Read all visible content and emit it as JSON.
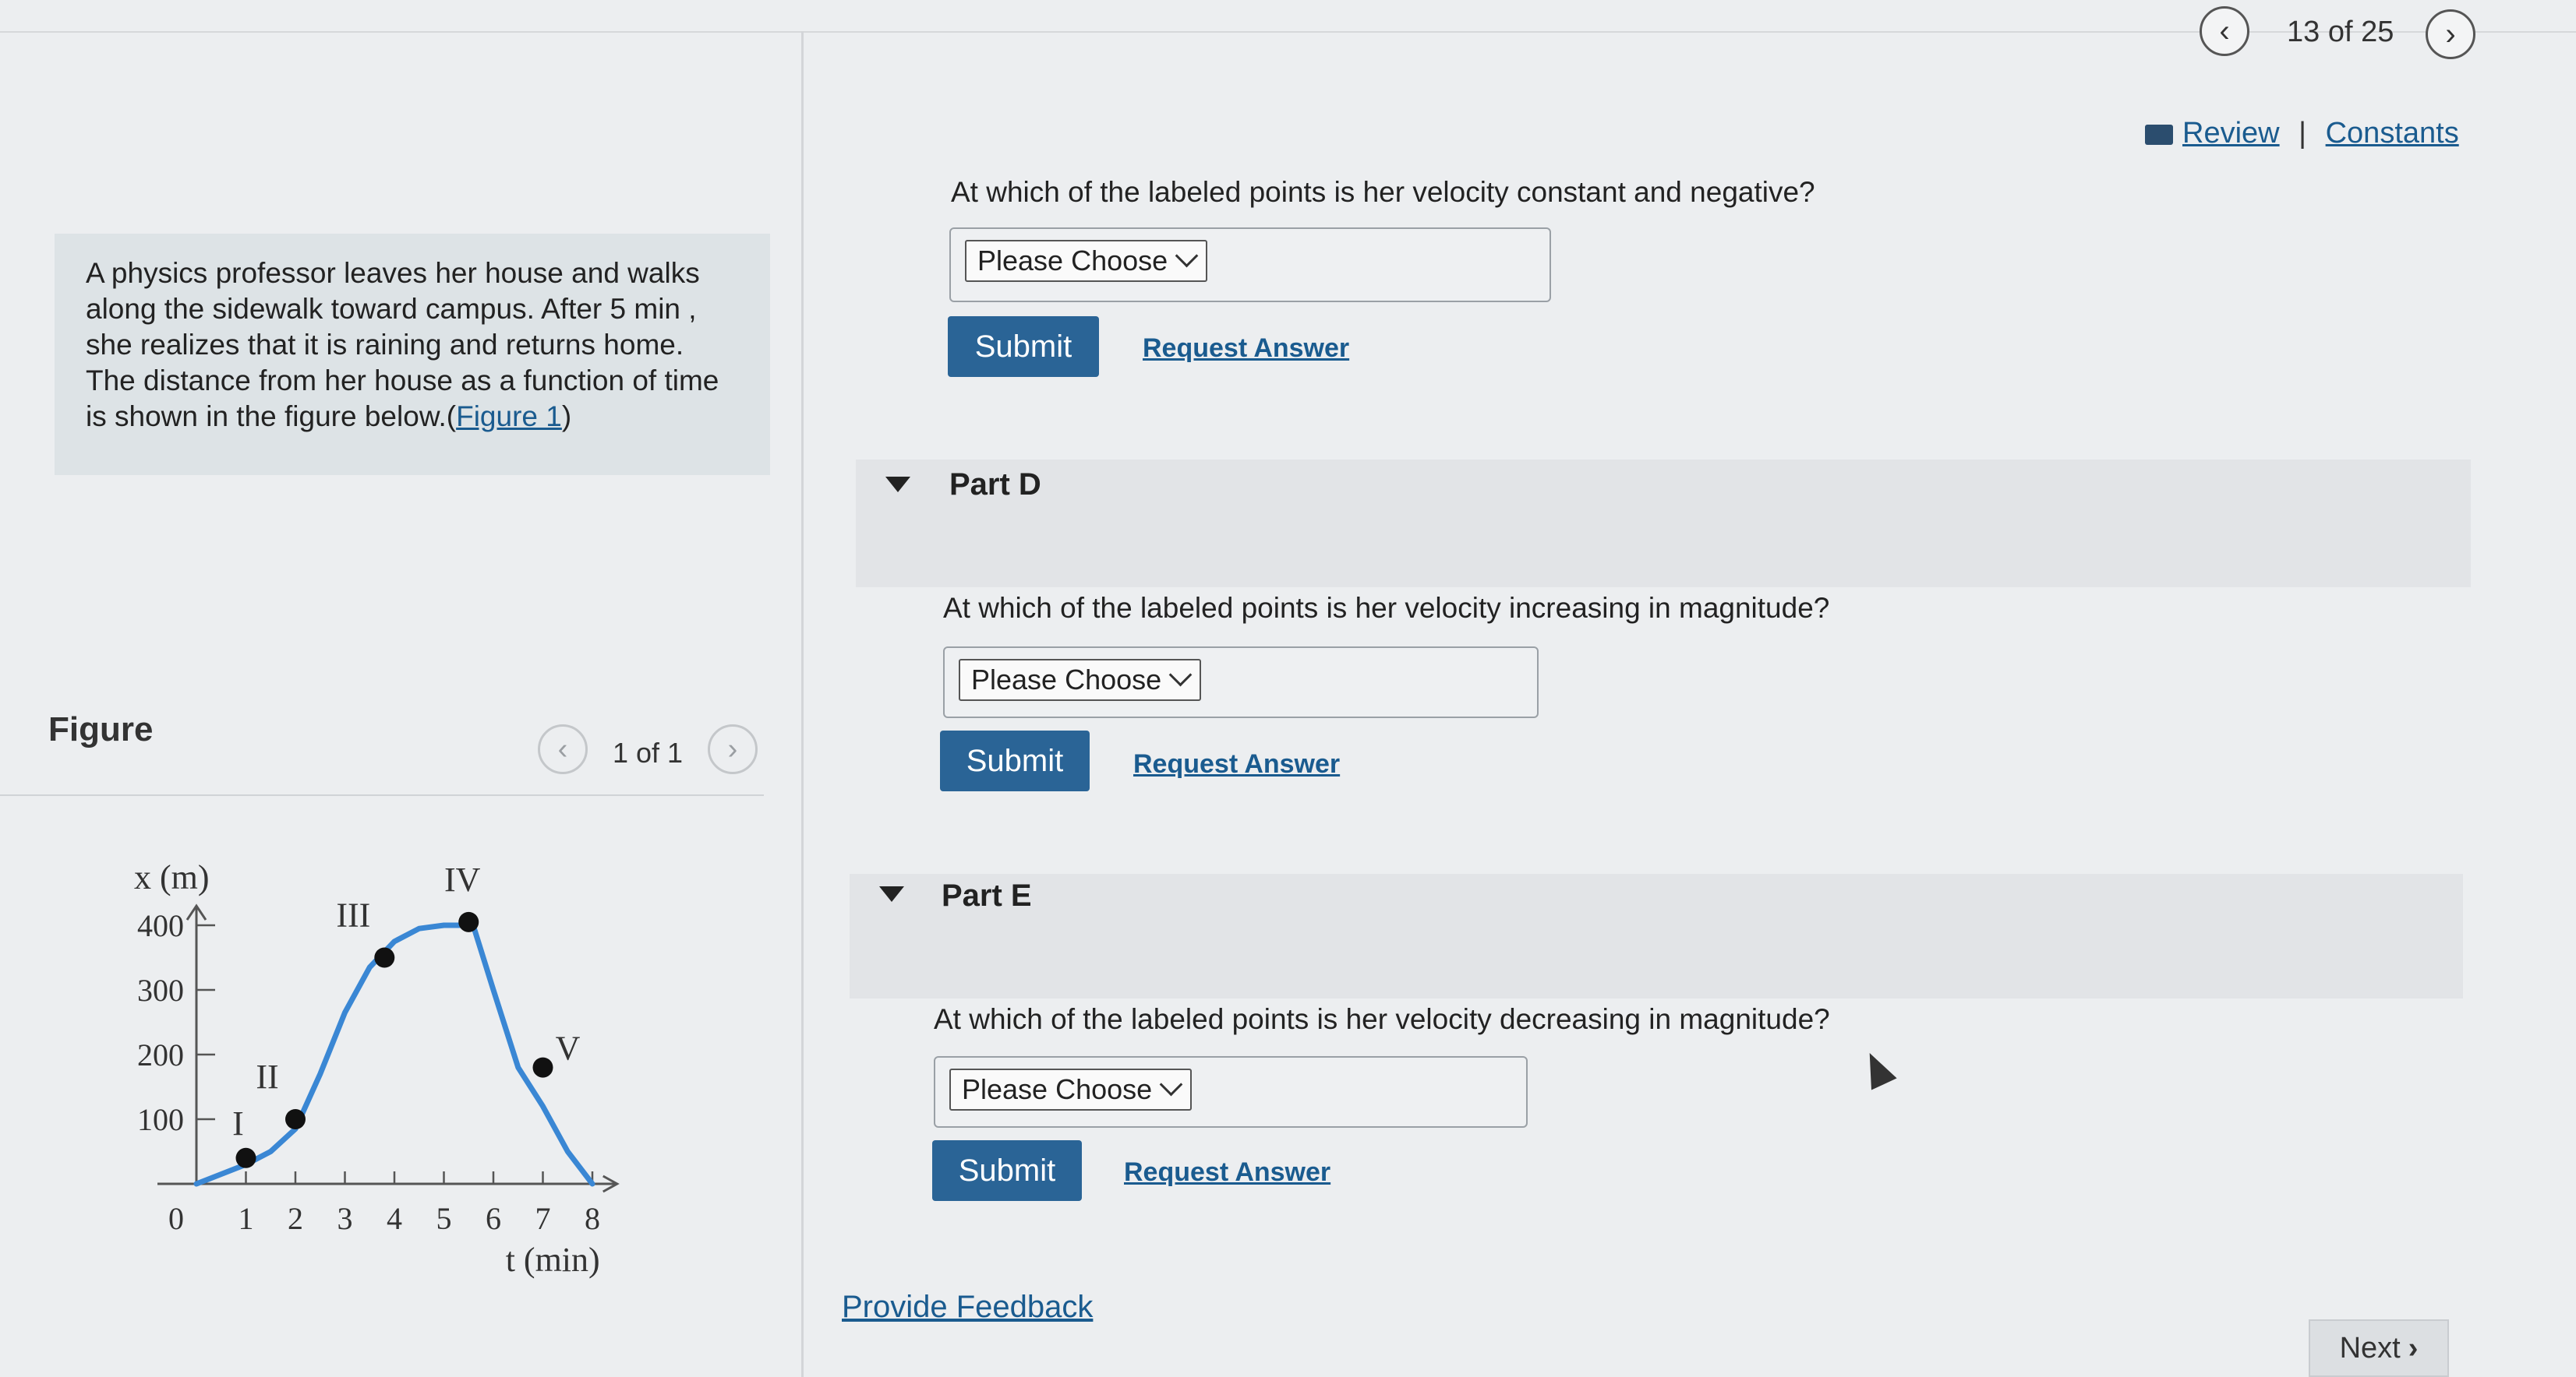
{
  "header": {
    "counter": "13 of 25",
    "review_label": "Review",
    "separator": "|",
    "constants_label": "Constants"
  },
  "problem": {
    "text": "A physics professor leaves her house and walks along the sidewalk toward campus. After 5 min , she realizes that it is raining and returns home. The distance from her house as a function of time is shown in the figure below.",
    "link_open": "(",
    "figure_link": "Figure 1",
    "link_close": ")"
  },
  "figure": {
    "title": "Figure",
    "count": "1 of 1"
  },
  "chart_data": {
    "type": "line",
    "ylabel": "x (m)",
    "xlabel": "t (min)",
    "x_ticks": [
      "0",
      "1",
      "2",
      "3",
      "4",
      "5",
      "6",
      "7",
      "8"
    ],
    "y_ticks": [
      "100",
      "200",
      "300",
      "400"
    ],
    "xlim": [
      0,
      8.5
    ],
    "ylim": [
      0,
      430
    ],
    "curve": [
      [
        0,
        0
      ],
      [
        1,
        30
      ],
      [
        1.5,
        50
      ],
      [
        2,
        85
      ],
      [
        2.5,
        170
      ],
      [
        3,
        265
      ],
      [
        3.5,
        335
      ],
      [
        4,
        375
      ],
      [
        4.5,
        395
      ],
      [
        5,
        400
      ],
      [
        5.5,
        400
      ],
      [
        5.6,
        398
      ],
      [
        6,
        300
      ],
      [
        6.5,
        180
      ],
      [
        7,
        120
      ],
      [
        7.5,
        50
      ],
      [
        8,
        0
      ]
    ],
    "points": [
      {
        "label": "I",
        "x": 1,
        "y": 40
      },
      {
        "label": "II",
        "x": 2,
        "y": 100
      },
      {
        "label": "III",
        "x": 3.8,
        "y": 350
      },
      {
        "label": "IV",
        "x": 5.5,
        "y": 405
      },
      {
        "label": "V",
        "x": 7,
        "y": 180
      }
    ]
  },
  "part_c": {
    "question": "At which of the labeled points is her velocity constant and negative?",
    "select": "Please Choose",
    "submit": "Submit",
    "request": "Request Answer"
  },
  "part_d": {
    "title": "Part D",
    "question": "At which of the labeled points is her velocity increasing in magnitude?",
    "select": "Please Choose",
    "submit": "Submit",
    "request": "Request Answer"
  },
  "part_e": {
    "title": "Part E",
    "question": "At which of the labeled points is her velocity decreasing in magnitude?",
    "select": "Please Choose",
    "submit": "Submit",
    "request": "Request Answer"
  },
  "footer": {
    "feedback": "Provide Feedback",
    "next": "Next"
  },
  "colors": {
    "accent": "#2a6496",
    "curve": "#3a87d4",
    "link": "#1a5b8f"
  }
}
